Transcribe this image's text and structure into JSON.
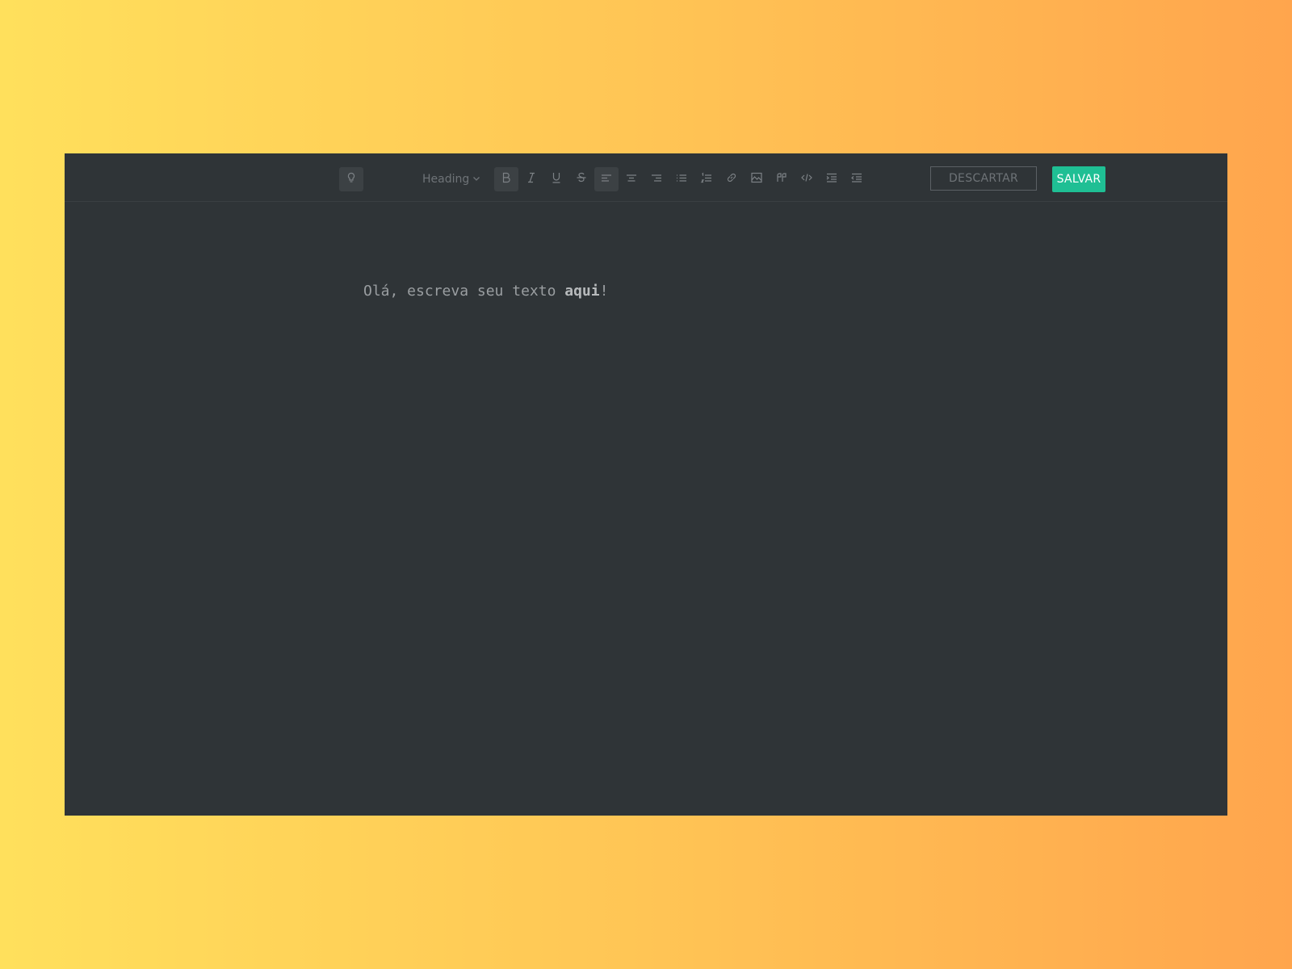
{
  "toolbar": {
    "theme_toggle_icon": "lightbulb-icon",
    "heading_label": "Heading",
    "format_buttons": [
      {
        "name": "bold",
        "icon": "bold-icon",
        "active": true
      },
      {
        "name": "italic",
        "icon": "italic-icon",
        "active": false
      },
      {
        "name": "underline",
        "icon": "underline-icon",
        "active": false
      },
      {
        "name": "strikethrough",
        "icon": "strikethrough-icon",
        "active": false
      },
      {
        "name": "align-left",
        "icon": "align-left-icon",
        "active": true
      },
      {
        "name": "align-center",
        "icon": "align-center-icon",
        "active": false
      },
      {
        "name": "align-right",
        "icon": "align-right-icon",
        "active": false
      },
      {
        "name": "bullet-list",
        "icon": "bullet-list-icon",
        "active": false
      },
      {
        "name": "numbered-list",
        "icon": "numbered-list-icon",
        "active": false
      },
      {
        "name": "link",
        "icon": "link-icon",
        "active": false
      },
      {
        "name": "image",
        "icon": "image-icon",
        "active": false
      },
      {
        "name": "quote",
        "icon": "quote-icon",
        "active": false
      },
      {
        "name": "code",
        "icon": "code-icon",
        "active": false
      },
      {
        "name": "indent",
        "icon": "indent-icon",
        "active": false
      },
      {
        "name": "outdent",
        "icon": "outdent-icon",
        "active": false
      }
    ],
    "discard_label": "DESCARTAR",
    "save_label": "SALVAR",
    "save_color": "#1fbf94"
  },
  "editor": {
    "text_before": "Olá, escreva seu texto ",
    "text_bold": "aqui",
    "text_after": "!"
  }
}
